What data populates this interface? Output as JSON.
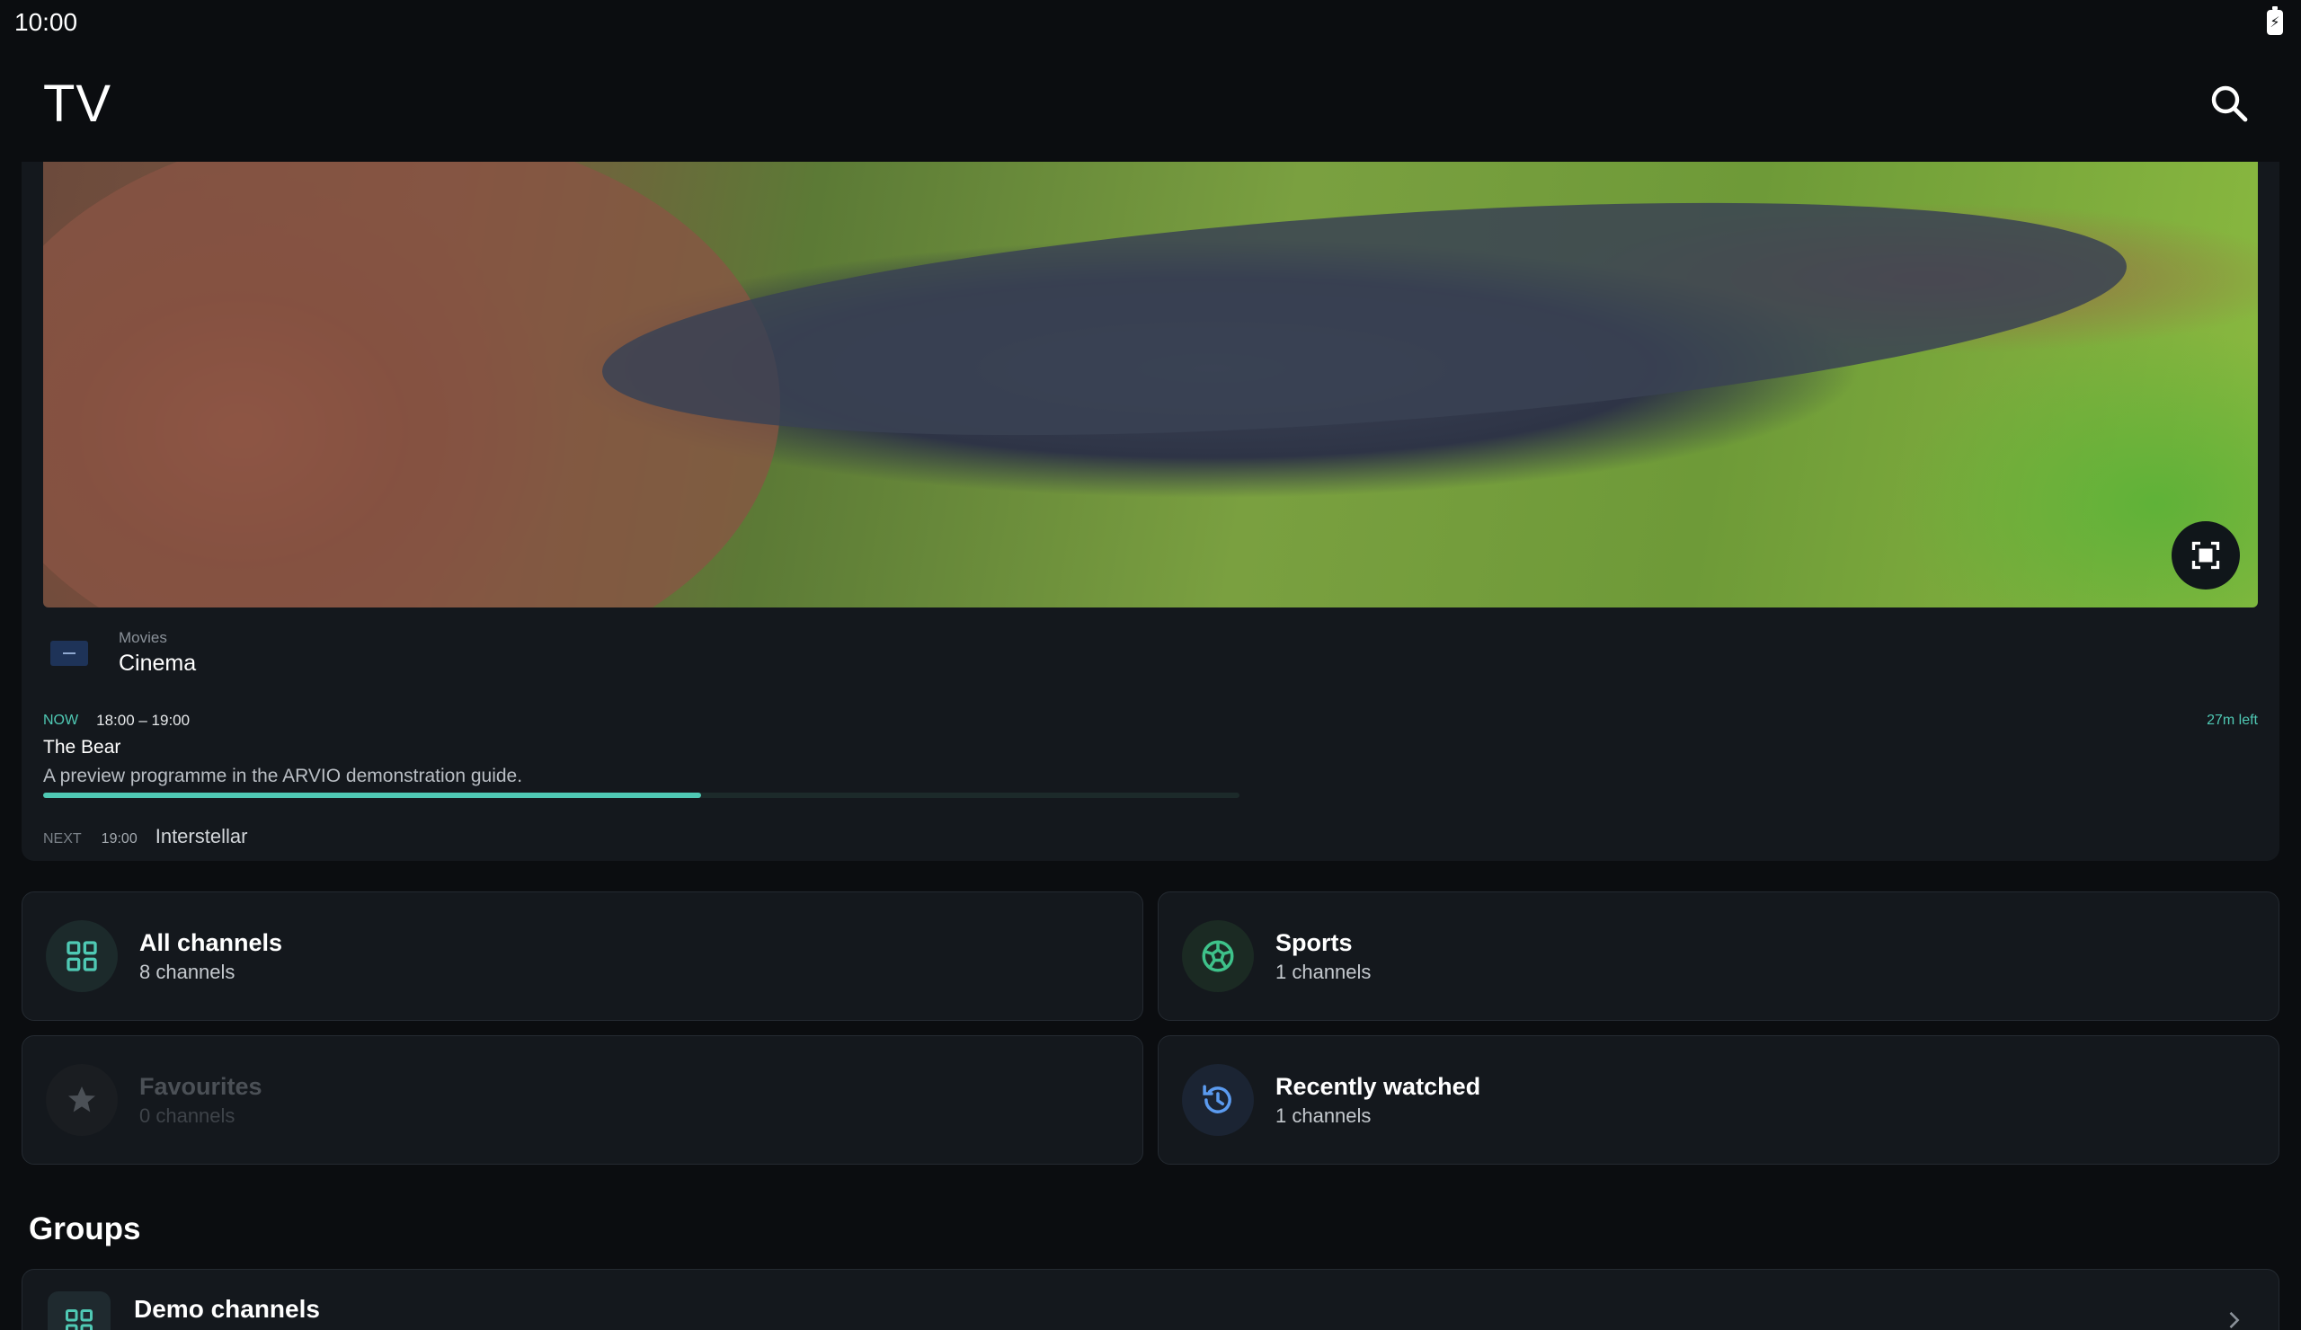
{
  "status_bar": {
    "time": "10:00",
    "battery_icon": "battery-charging-icon"
  },
  "app_bar": {
    "title": "TV",
    "search_icon": "search-icon"
  },
  "player": {
    "fullscreen_icon": "fullscreen-icon",
    "channel": {
      "category": "Movies",
      "name": "Cinema"
    },
    "now": {
      "label": "NOW",
      "time_range": "18:00 – 19:00",
      "time_left": "27m left",
      "title": "The Bear",
      "description": "A preview programme in the ARVIO demonstration guide.",
      "progress": 0.55
    },
    "next": {
      "label": "NEXT",
      "time": "19:00",
      "title": "Interstellar"
    }
  },
  "tiles": {
    "all_channels": {
      "title": "All channels",
      "subtitle": "8 channels",
      "icon": "grid-icon",
      "accent": "#4fc9b4"
    },
    "sports": {
      "title": "Sports",
      "subtitle": "1 channels",
      "icon": "soccer-ball-icon",
      "accent": "#3ec28a"
    },
    "favourites": {
      "title": "Favourites",
      "subtitle": "0 channels",
      "icon": "star-icon",
      "accent": "#4b5056"
    },
    "recently_watched": {
      "title": "Recently watched",
      "subtitle": "1 channels",
      "icon": "history-icon",
      "accent": "#5b9bf0"
    }
  },
  "groups": {
    "heading": "Groups",
    "items": [
      {
        "title": "Demo channels",
        "icon": "grid-icon"
      }
    ]
  },
  "colors": {
    "background": "#0b0d10",
    "surface": "#14181d",
    "accent": "#4fc9b4"
  }
}
